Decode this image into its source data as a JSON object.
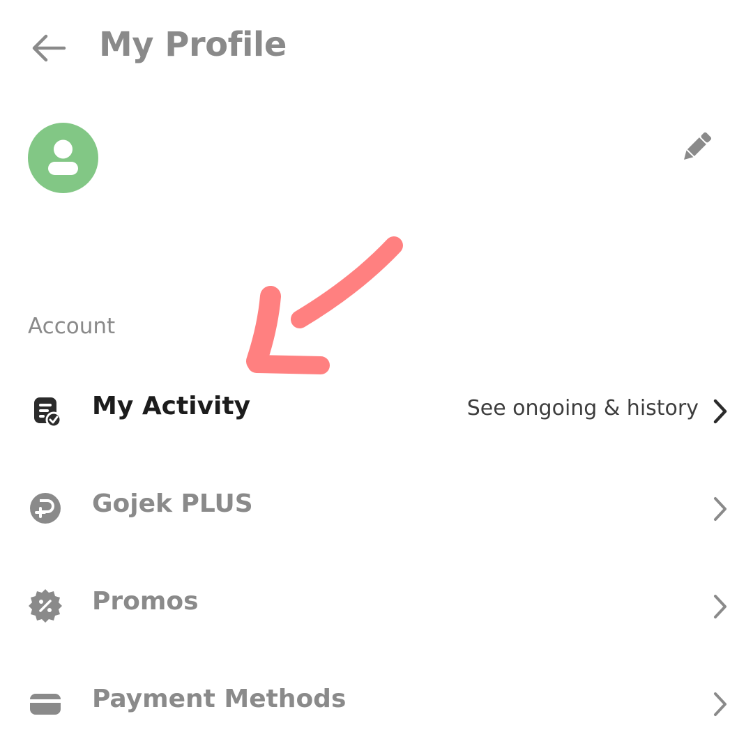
{
  "header": {
    "title": "My Profile",
    "back_icon": "arrow-left-icon"
  },
  "profile": {
    "avatar_icon": "user-icon",
    "avatar_color": "#82c785",
    "edit_icon": "pencil-icon"
  },
  "annotation": {
    "arrow_icon": "hand-drawn-arrow-icon",
    "color": "#ff8080"
  },
  "account": {
    "section_label": "Account",
    "items": [
      {
        "label": "My Activity",
        "hint": "See ongoing & history",
        "icon": "activity-check-icon",
        "highlighted": true
      },
      {
        "label": "Gojek PLUS",
        "hint": "",
        "icon": "gojek-plus-icon",
        "highlighted": false
      },
      {
        "label": "Promos",
        "hint": "",
        "icon": "promo-badge-icon",
        "highlighted": false
      },
      {
        "label": "Payment Methods",
        "hint": "",
        "icon": "credit-card-icon",
        "highlighted": false
      }
    ]
  }
}
